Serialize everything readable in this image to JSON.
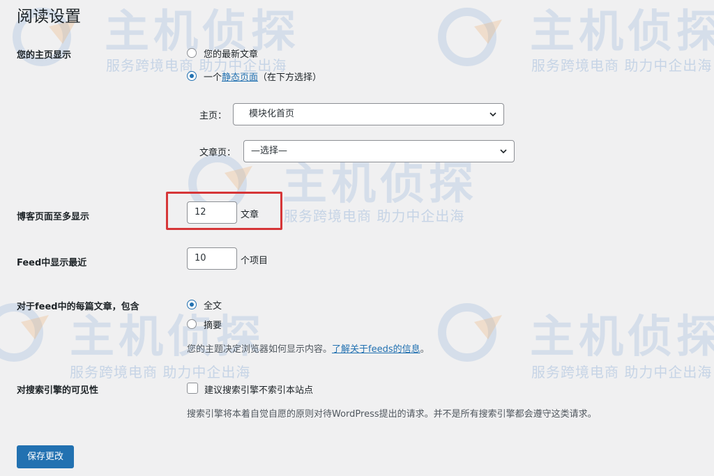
{
  "page_title": "阅读设置",
  "homepage_display": {
    "label": "您的主页显示",
    "option_latest": "您的最新文章",
    "option_static_prefix": "一个",
    "option_static_link": "静态页面",
    "option_static_suffix": "（在下方选择）",
    "selected": "static",
    "homepage_label": "主页：",
    "homepage_value": "模块化首页",
    "posts_page_label": "文章页：",
    "posts_page_value": "—选择—"
  },
  "blog_pages": {
    "label": "博客页面至多显示",
    "value": "12",
    "unit": "文章"
  },
  "feed_recent": {
    "label": "Feed中显示最近",
    "value": "10",
    "unit": "个项目"
  },
  "feed_content": {
    "label": "对于feed中的每篇文章，包含",
    "option_full": "全文",
    "option_summary": "摘要",
    "selected": "full",
    "hint_prefix": "您的主题决定浏览器如何显示内容。",
    "hint_link": "了解关于feeds的信息",
    "hint_suffix": "。"
  },
  "search_visibility": {
    "label": "对搜索引擎的可见性",
    "checkbox_label": "建议搜索引擎不索引本站点",
    "checked": false,
    "hint": "搜索引擎将本着自觉自愿的原则对待WordPress提出的请求。并不是所有搜索引擎都会遵守这类请求。"
  },
  "save_button": "保存更改",
  "watermark": {
    "logo": "主机侦探",
    "slogan": "服务跨境电商  助力中企出海"
  },
  "colors": {
    "accent": "#2271b1",
    "highlight": "#d63638",
    "background": "#f0f0f1"
  }
}
